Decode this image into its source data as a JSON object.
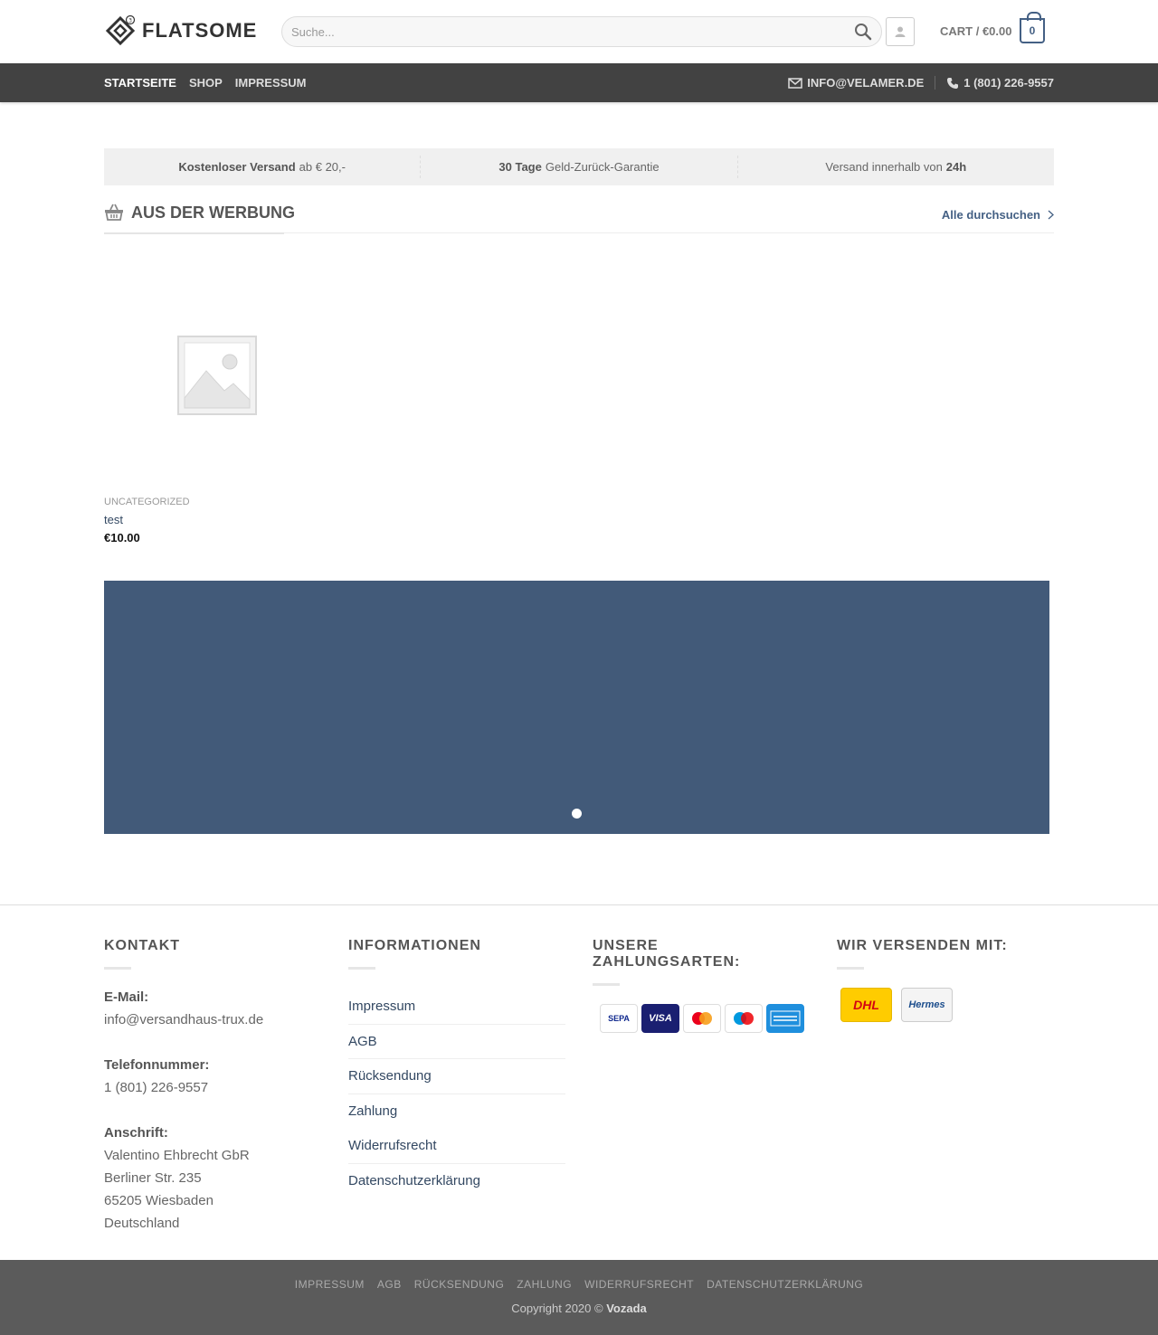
{
  "header": {
    "logo_text": "FLATSOME",
    "search_placeholder": "Suche...",
    "cart_label": "CART / €0.00",
    "cart_count": "0"
  },
  "nav": {
    "items": [
      {
        "label": "STARTSEITE"
      },
      {
        "label": "SHOP"
      },
      {
        "label": "IMPRESSUM"
      }
    ],
    "email": "INFO@VELAMER.DE",
    "phone": "1 (801) 226-9557"
  },
  "info_bar": {
    "cell1_bold": "Kostenloser Versand",
    "cell1_text": "ab € 20,-",
    "cell2_bold": "30 Tage",
    "cell2_text": "Geld-Zurück-Garantie",
    "cell3_text": "Versand innerhalb von",
    "cell3_bold": "24h"
  },
  "section": {
    "title": "AUS DER WERBUNG",
    "more_label": "Alle durchsuchen"
  },
  "product": {
    "category": "UNCATEGORIZED",
    "name": "test",
    "price": "€10.00"
  },
  "footer": {
    "kontakt": {
      "heading": "KONTAKT",
      "email_label": "E-Mail:",
      "email_value": "info@versandhaus-trux.de",
      "phone_label": "Telefonnummer:",
      "phone_value": "1 (801) 226-9557",
      "address_label": "Anschrift:",
      "address_line1": "Valentino Ehbrecht GbR",
      "address_line2": "Berliner Str. 235",
      "address_line3": "65205 Wiesbaden",
      "address_line4": "Deutschland"
    },
    "informationen": {
      "heading": "INFORMATIONEN",
      "links": [
        "Impressum",
        "AGB",
        "Rücksendung",
        "Zahlung",
        "Widerrufsrecht",
        "Datenschutzerklärung"
      ]
    },
    "zahlungsarten": {
      "heading": "UNSERE ZAHLUNGSARTEN:",
      "icons": [
        "sepa-icon",
        "visa-icon",
        "mastercard-icon",
        "maestro-icon",
        "american-express-icon"
      ],
      "sepa_label": "SEPA",
      "visa_label": "VISA"
    },
    "versand": {
      "heading": "WIR VERSENDEN MIT:",
      "dhl_label": "DHL",
      "hermes_label": "Hermes"
    },
    "bottom_links": [
      "IMPRESSUM",
      "AGB",
      "RÜCKSENDUNG",
      "ZAHLUNG",
      "WIDERRUFSRECHT",
      "DATENSCHUTZERKLÄRUNG"
    ],
    "copyright_text": "Copyright 2020 ©",
    "copyright_brand": "Vozada"
  },
  "colors": {
    "nav_bg": "#424242",
    "accent": "#446084",
    "banner_bg": "#425a79",
    "footer_bottom_bg": "#5b5b5b"
  }
}
